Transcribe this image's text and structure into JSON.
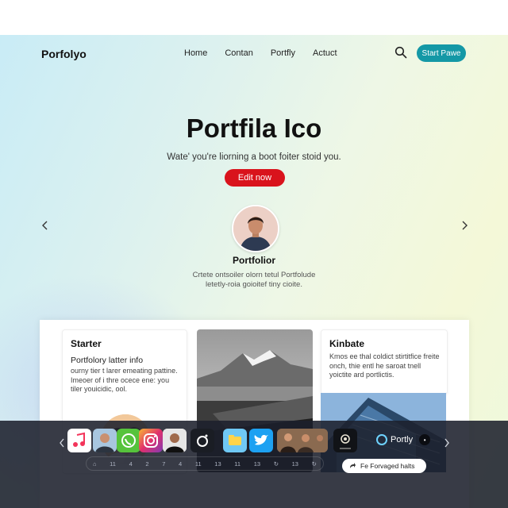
{
  "nav": {
    "brand": "Porfolyo",
    "links": [
      "Home",
      "Contan",
      "Portfly",
      "Actuct"
    ],
    "cta": "Start Pawe"
  },
  "hero": {
    "title": "Portfila Ico",
    "subtitle": "Wate' you're liorning a boot foiter stoid you.",
    "button": "Edit now"
  },
  "profile": {
    "name": "Portfolior",
    "bio": "Crtete ontsoiler olorn tetul Portfolude letetly-roia goioitef tiny cioite."
  },
  "cards": {
    "starter": {
      "title": "Starter",
      "heading": "Portfolory latter info",
      "text": "ourny tier t larer emeating pattine. Imeoer of i thre ocece ene: you tiler youicidic, ool."
    },
    "kinbate": {
      "title": "Kinbate",
      "text": "Kmos ee thal coldict stirtitfice freite onch, thie entl he saroat tnell yoictite ard portlictis."
    }
  },
  "dock": {
    "ticks": [
      "⌂",
      "11",
      "4",
      "2",
      "7",
      "4",
      "11",
      "13",
      "11",
      "13",
      "↻",
      "13",
      "↻"
    ],
    "brand": "Portly",
    "brand_badge": "•",
    "pill": "Fe Forvaged halts",
    "apps": [
      "music-app",
      "person-app",
      "whatsapp-app",
      "instagram-app",
      "person-app-2",
      "circle-app",
      "folder-app",
      "twitter-app",
      "photos-app",
      "photos-app-2",
      "settings-app"
    ]
  },
  "colors": {
    "accent_teal": "#1498a6",
    "accent_red": "#d9131c",
    "dock_bg": "#1c202c",
    "twitter_blue": "#1da1f2"
  }
}
